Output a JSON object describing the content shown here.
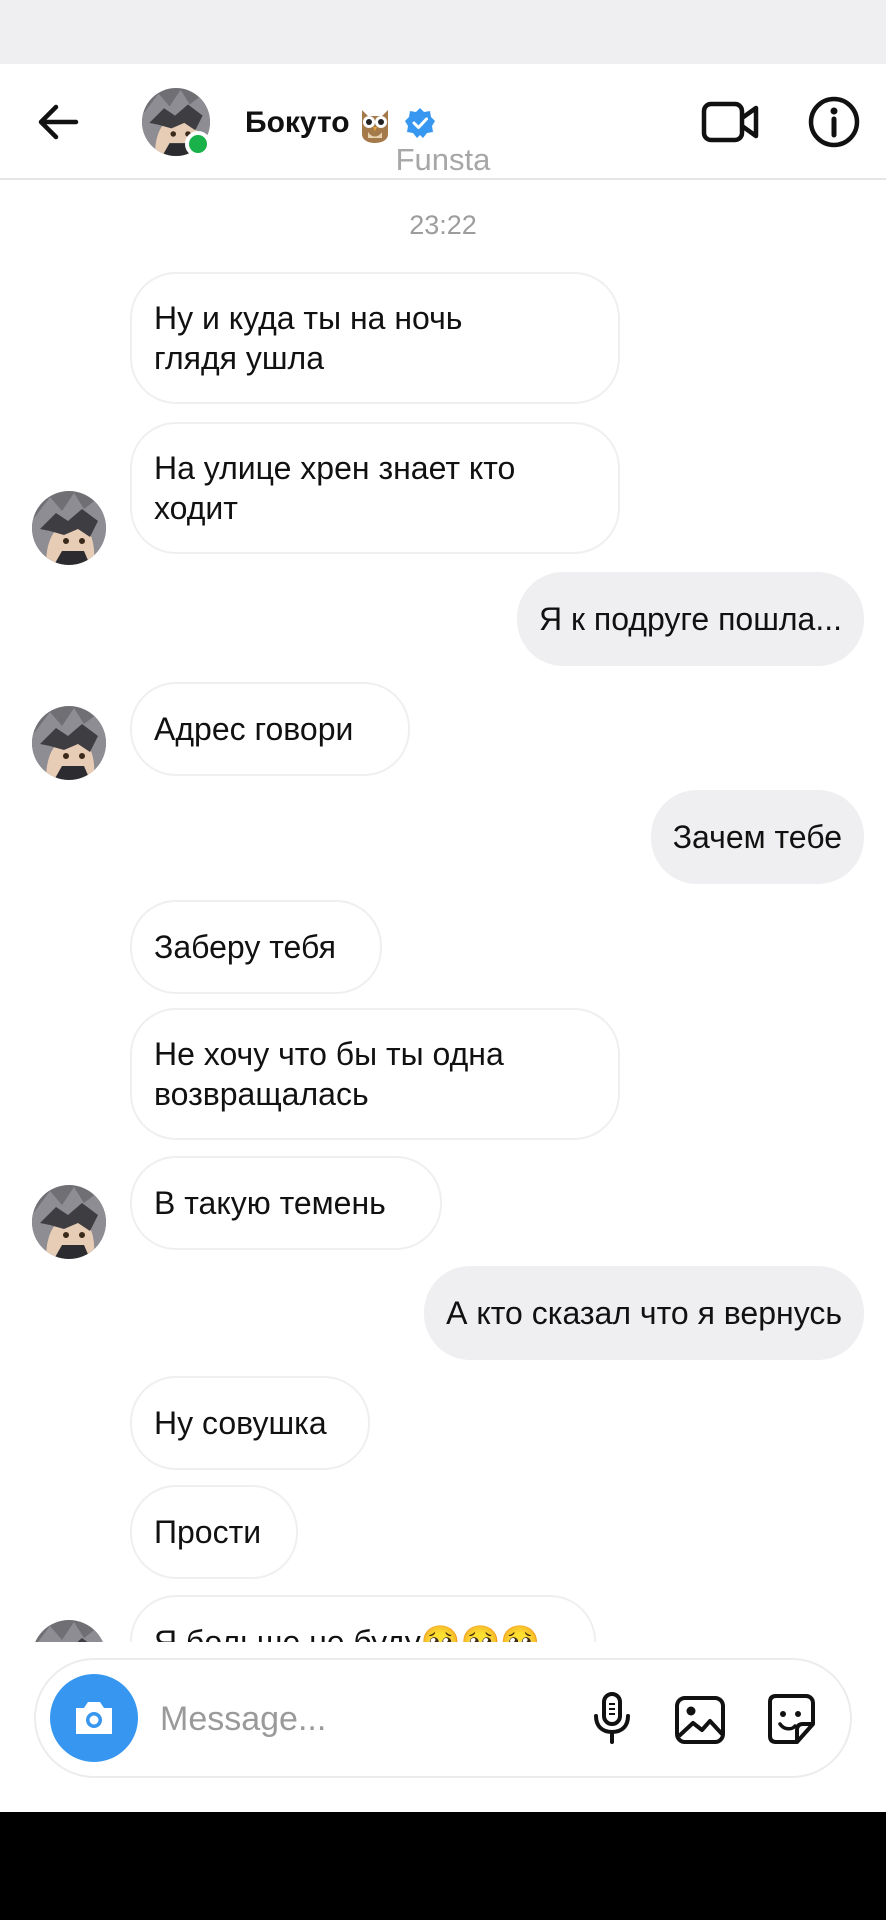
{
  "header": {
    "contact_name": "Бокуто",
    "subtitle": "Funsta",
    "back_icon": "arrow-left-icon",
    "video_icon": "video-camera-icon",
    "info_icon": "info-icon",
    "owl_emoji": "🦉",
    "verified_color": "#3897f0",
    "online_color": "#19b24a"
  },
  "chat": {
    "timestamp": "23:22",
    "messages": [
      {
        "from": "them",
        "text": [
          "Ну и куда ты на ночь",
          "глядя ушла"
        ]
      },
      {
        "from": "them",
        "text": [
          "На улице хрен знает кто",
          "ходит"
        ]
      },
      {
        "from": "me",
        "text": [
          "Я к подруге пошла..."
        ]
      },
      {
        "from": "them",
        "text": [
          "Адрес говори"
        ]
      },
      {
        "from": "me",
        "text": [
          "Зачем тебе"
        ]
      },
      {
        "from": "them",
        "text": [
          "Заберу тебя"
        ]
      },
      {
        "from": "them",
        "text": [
          "Не хочу что бы ты одна",
          "возвращалась"
        ]
      },
      {
        "from": "them",
        "text": [
          "В такую темень"
        ]
      },
      {
        "from": "me",
        "text": [
          "А кто сказал что я вернусь"
        ]
      },
      {
        "from": "them",
        "text": [
          "Ну совушка"
        ]
      },
      {
        "from": "them",
        "text": [
          "Прости"
        ]
      },
      {
        "from": "them",
        "text": [
          "Я больше не буду🥺🥺🥺"
        ]
      }
    ]
  },
  "composer": {
    "placeholder": "Message...",
    "camera_icon": "camera-icon",
    "mic_icon": "microphone-icon",
    "gallery_icon": "image-icon",
    "sticker_icon": "sticker-icon",
    "accent_color": "#3797f0"
  }
}
